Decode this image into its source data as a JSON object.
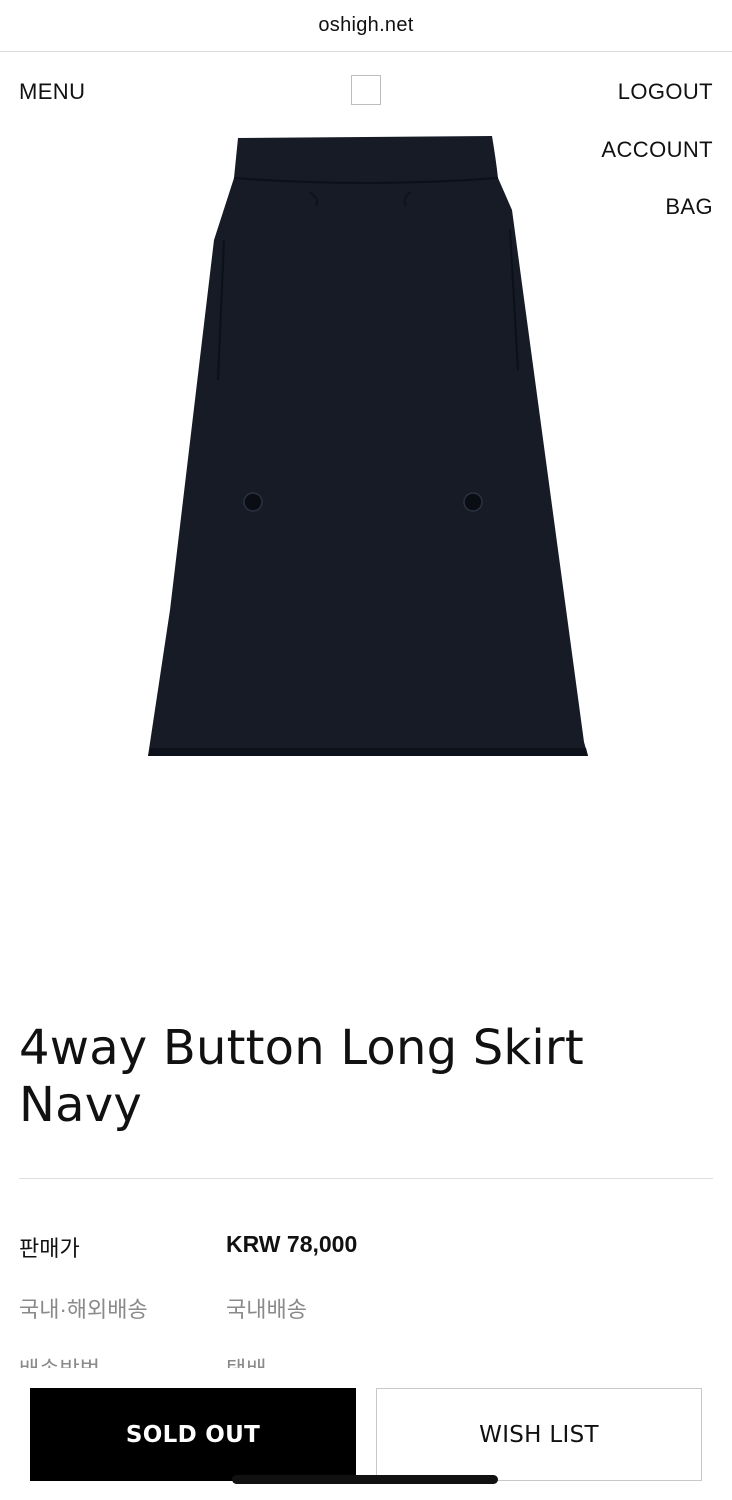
{
  "browser": {
    "url": "oshigh.net"
  },
  "nav": {
    "menu": "MENU",
    "logout": "LOGOUT",
    "account": "ACCOUNT",
    "bag": "BAG"
  },
  "product": {
    "title_line1": "4way Button Long Skirt",
    "title_line2": "Navy",
    "image_color": "#161b26",
    "info": [
      {
        "label": "판매가",
        "value": "KRW 78,000"
      },
      {
        "label": "국내·해외배송",
        "value": "국내배송"
      },
      {
        "label": "배송방법",
        "value": "택배"
      }
    ]
  },
  "actions": {
    "sold_out": "SOLD OUT",
    "wish_list": "WISH LIST"
  }
}
